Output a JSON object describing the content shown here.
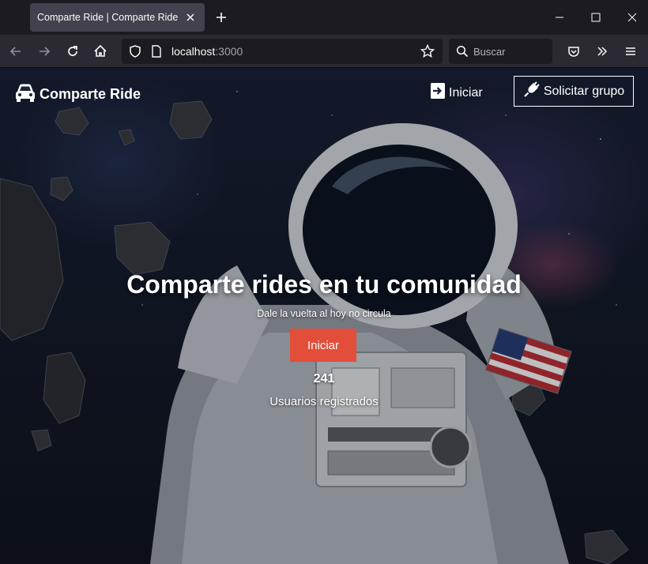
{
  "browser": {
    "tab_title": "Comparte Ride | Comparte Ride",
    "url_host": "localhost",
    "url_port": ":3000",
    "search_placeholder": "Buscar"
  },
  "header": {
    "brand": "Comparte Ride",
    "login_label": "Iniciar",
    "group_label": "Solicitar grupo"
  },
  "hero": {
    "title": "Comparte rides en tu comunidad",
    "subtitle": "Dale la vuelta al hoy no circula",
    "cta_label": "Iniciar",
    "users_count": "241",
    "users_label": "Usuarios registrados"
  },
  "colors": {
    "cta": "#e24e3a",
    "chrome_bg": "#1c1b22",
    "toolbar_bg": "#2b2a33"
  },
  "icons": [
    "close-icon",
    "plus-icon",
    "minimize-icon",
    "maximize-icon",
    "back-icon",
    "forward-icon",
    "reload-icon",
    "home-icon",
    "shield-icon",
    "page-icon",
    "star-icon",
    "search-icon",
    "pocket-icon",
    "extensions-icon",
    "menu-icon",
    "car-icon",
    "sign-in-icon",
    "plug-icon"
  ]
}
